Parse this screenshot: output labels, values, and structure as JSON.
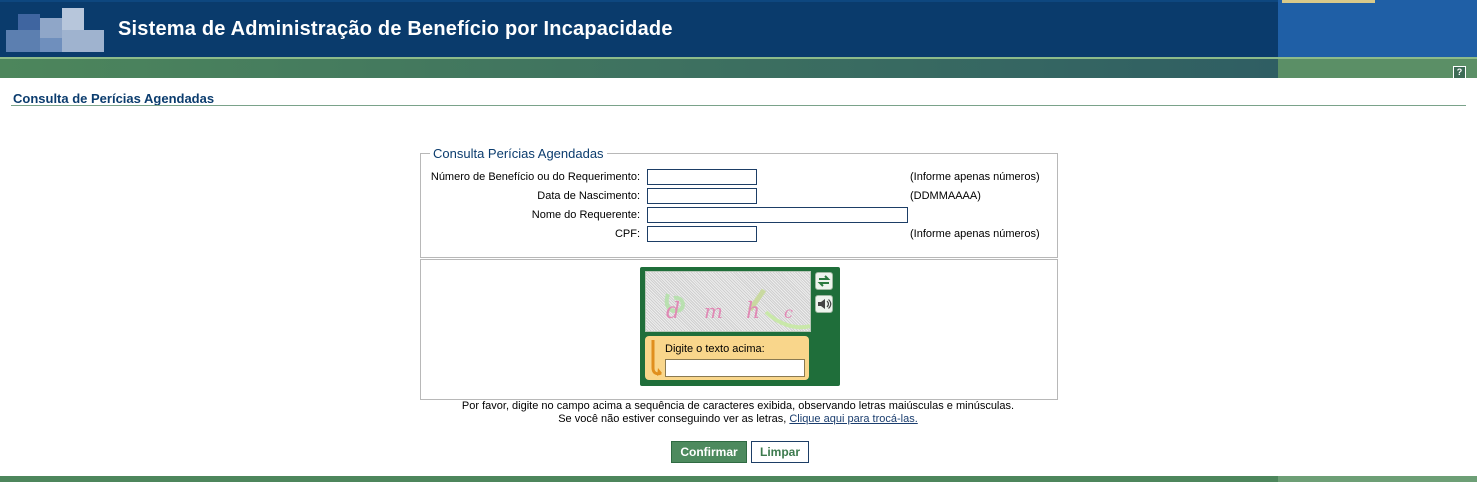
{
  "header": {
    "title": "Sistema de Administração de Benefício por Incapacidade",
    "help_label": "?"
  },
  "page": {
    "title": "Consulta de Perícias Agendadas"
  },
  "form": {
    "legend": "Consulta Perícias Agendadas",
    "fields": [
      {
        "label": "Número de Benefício ou do Requerimento:",
        "value": "",
        "hint": "(Informe apenas números)"
      },
      {
        "label": "Data de Nascimento:",
        "value": "",
        "hint": "(DDMMAAAA)"
      },
      {
        "label": "Nome do Requerente:",
        "value": "",
        "hint": ""
      },
      {
        "label": "CPF:",
        "value": "",
        "hint": "(Informe apenas números)"
      }
    ]
  },
  "captcha": {
    "refresh_icon": "refresh-icon",
    "audio_icon": "speaker-icon",
    "input_label": "Digite o texto acima:",
    "input_value": "",
    "instructions_line1": "Por favor, digite no campo acima a sequência de caracteres exibida, observando letras maiúsculas e minúsculas.",
    "instructions_line2_prefix": "Se você não estiver conseguindo ver as letras,",
    "instructions_link": "Clique aqui para trocá-las."
  },
  "buttons": {
    "confirm": "Confirmar",
    "clear": "Limpar"
  },
  "colors": {
    "header_blue": "#0a3b6c",
    "green_bar": "#4d865c",
    "title_blue": "#0b3c6e",
    "captcha_green": "#1f6e3a",
    "captcha_yellow": "#f9d68b"
  }
}
